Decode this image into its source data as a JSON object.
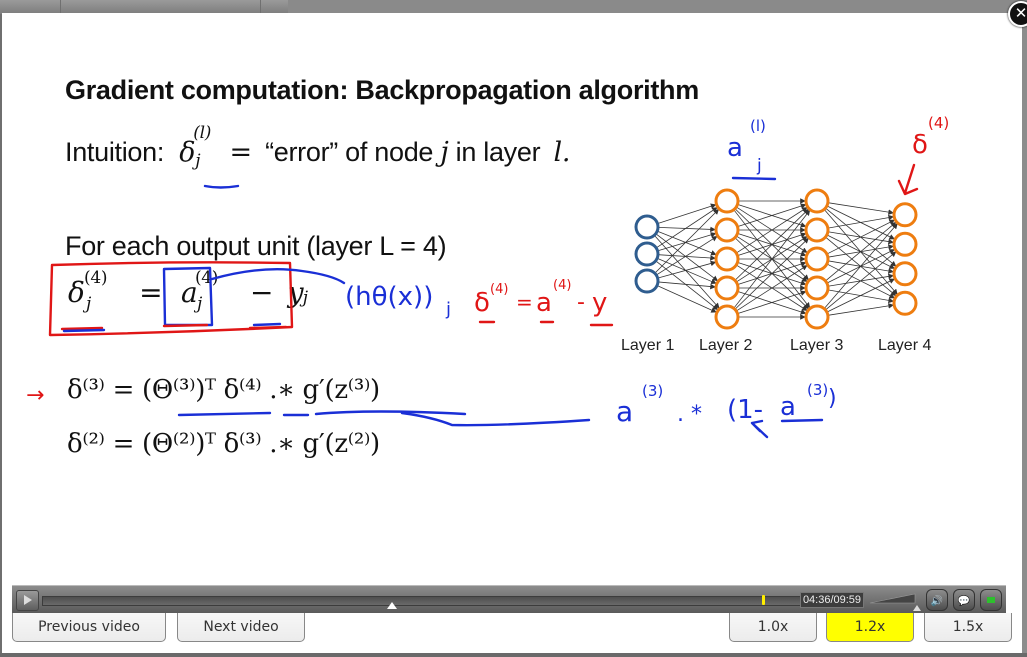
{
  "window": {
    "close_icon": "close-icon",
    "close_glyph": "✕"
  },
  "slide": {
    "title": "Gradient computation: Backpropagation algorithm",
    "intuition": {
      "label": "Intuition:",
      "symbol": "δ",
      "symbol_sup": "(l)",
      "symbol_sub": "j",
      "eq": "=",
      "text": "“error” of node",
      "j": "j",
      "text2": "in layer",
      "l": "l."
    },
    "output_unit_heading": "For each output unit (layer L = 4)",
    "equations": {
      "eq4": {
        "lhs": "δ",
        "lhs_sub": "j",
        "lhs_sup": "(4)",
        "op": "=",
        "a": "a",
        "a_sub": "j",
        "a_sup": "(4)",
        "minus": "−",
        "y": "y",
        "y_sub": "j"
      },
      "eq3": "δ⁽³⁾ = (Θ⁽³⁾)ᵀ δ⁽⁴⁾ .∗ g′(z⁽³⁾)",
      "eq2": "δ⁽²⁾ = (Θ⁽²⁾)ᵀ δ⁽³⁾ .∗ g′(z⁽²⁾)"
    },
    "annotations": {
      "a_l_j": {
        "base": "a",
        "sup": "(l)",
        "sub": "j"
      },
      "delta4_label": {
        "base": "δ",
        "sup": "(4)"
      },
      "h_theta": {
        "text": "(hθ(x))",
        "sub": "j"
      },
      "vectorized": {
        "delta": "δ",
        "delta_sup": "(4)",
        "eq": "=",
        "a": "a",
        "a_sup": "(4)",
        "minus": "-",
        "y": "y"
      },
      "g_prime": {
        "a1": "a",
        "a1_sup": "(3)",
        "op": ". *",
        "paren": "(1-",
        "a2": "a",
        "a2_sup": "(3)",
        "close": ")"
      },
      "arrow": "→"
    },
    "network": {
      "layers": [
        {
          "label": "Layer 1",
          "units": 3,
          "color": "#2f5d8f"
        },
        {
          "label": "Layer 2",
          "units": 5,
          "color": "#ee7d10"
        },
        {
          "label": "Layer 3",
          "units": 5,
          "color": "#ee7d10"
        },
        {
          "label": "Layer 4",
          "units": 4,
          "color": "#ee7d10"
        }
      ]
    }
  },
  "player": {
    "play_icon": "play-icon",
    "current_time": "04:36",
    "duration": "09:59",
    "time_display": "04:36/09:59",
    "progress_fraction": 0.461,
    "buffered_marker_fraction": 0.949,
    "volume_fraction": 0.9,
    "mute_icon": "speaker-icon",
    "captions_icon": "speech-bubble-icon",
    "hd_icon": "screen-icon",
    "mute_glyph": "🔊",
    "captions_glyph": "💬"
  },
  "navigation": {
    "previous": "Previous video",
    "next": "Next video"
  },
  "speed": {
    "options": [
      "1.0x",
      "1.2x",
      "1.5x"
    ],
    "selected": "1.2x",
    "highlight_color": "#ffff00"
  }
}
